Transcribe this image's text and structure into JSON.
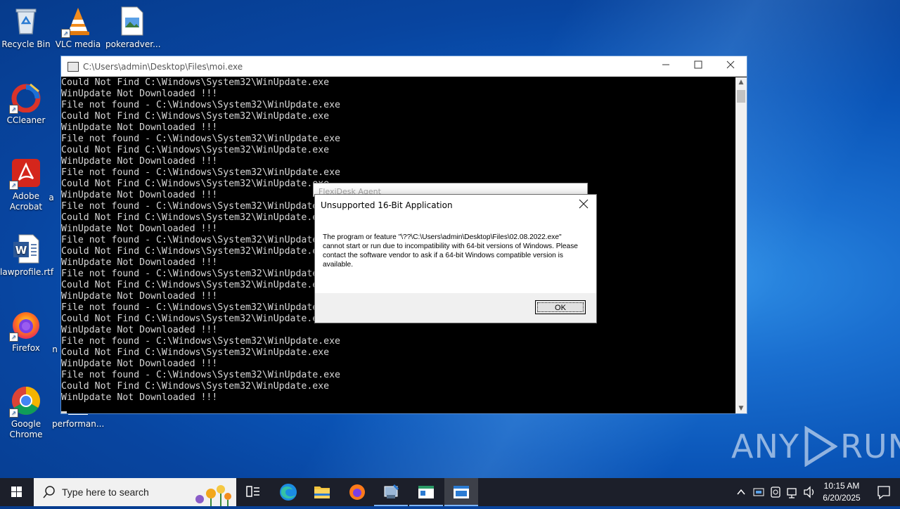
{
  "desktop": {
    "icons": [
      {
        "label": "Recycle Bin",
        "icon": "recycle-bin-icon"
      },
      {
        "label": "VLC media",
        "icon": "vlc-icon"
      },
      {
        "label": "pokeradver...",
        "icon": "image-file-icon"
      },
      {
        "label": "CCleaner",
        "icon": "ccleaner-icon"
      },
      {
        "label": "Adobe Acrobat",
        "icon": "acrobat-icon"
      },
      {
        "label": "lawprofile.rtf",
        "icon": "word-doc-icon"
      },
      {
        "label": "Firefox",
        "icon": "firefox-icon"
      },
      {
        "label": "Google Chrome",
        "icon": "chrome-icon"
      },
      {
        "label": "performan...",
        "icon": "file-icon"
      },
      {
        "label": "a",
        "icon": "file-icon"
      },
      {
        "label": "n",
        "icon": "file-icon"
      }
    ]
  },
  "console": {
    "title": "C:\\Users\\admin\\Desktop\\Files\\moi.exe",
    "lines": [
      "Could Not Find C:\\Windows\\System32\\WinUpdate.exe",
      "WinUpdate Not Downloaded !!!",
      "File not found - C:\\Windows\\System32\\WinUpdate.exe",
      "Could Not Find C:\\Windows\\System32\\WinUpdate.exe",
      "WinUpdate Not Downloaded !!!",
      "File not found - C:\\Windows\\System32\\WinUpdate.exe",
      "Could Not Find C:\\Windows\\System32\\WinUpdate.exe",
      "WinUpdate Not Downloaded !!!",
      "File not found - C:\\Windows\\System32\\WinUpdate.exe",
      "Could Not Find C:\\Windows\\System32\\WinUpdate.exe",
      "WinUpdate Not Downloaded !!!",
      "File not found - C:\\Windows\\System32\\WinUpdate.exe",
      "Could Not Find C:\\Windows\\System32\\WinUpdate.exe",
      "WinUpdate Not Downloaded !!!",
      "File not found - C:\\Windows\\System32\\WinUpdate.exe",
      "Could Not Find C:\\Windows\\System32\\WinUpdate.exe",
      "WinUpdate Not Downloaded !!!",
      "File not found - C:\\Windows\\System32\\WinUpdate.exe",
      "Could Not Find C:\\Windows\\System32\\WinUpdate.exe",
      "WinUpdate Not Downloaded !!!",
      "File not found - C:\\Windows\\System32\\WinUpdate.exe",
      "Could Not Find C:\\Windows\\System32\\WinUpdate.exe",
      "WinUpdate Not Downloaded !!!",
      "File not found - C:\\Windows\\System32\\WinUpdate.exe",
      "Could Not Find C:\\Windows\\System32\\WinUpdate.exe",
      "WinUpdate Not Downloaded !!!",
      "File not found - C:\\Windows\\System32\\WinUpdate.exe",
      "Could Not Find C:\\Windows\\System32\\WinUpdate.exe",
      "WinUpdate Not Downloaded !!!"
    ]
  },
  "background_dialog": {
    "title": "FlexiDesk Agent"
  },
  "dialog": {
    "title": "Unsupported 16-Bit Application",
    "message": "The program or feature \"\\??\\C:\\Users\\admin\\Desktop\\Files\\02.08.2022.exe\" cannot start or run due to incompatibility with 64-bit versions of Windows. Please contact the software vendor to ask if a 64-bit Windows compatible version is available.",
    "ok_label": "OK"
  },
  "watermark": {
    "left": "ANY",
    "right": "RUN"
  },
  "taskbar": {
    "search_placeholder": "Type here to search",
    "time": "10:15 AM",
    "date": "6/20/2025"
  },
  "colors": {
    "console_bg": "#000000",
    "console_text": "#d8d8d8",
    "taskbar": "#1c1f2a",
    "accent": "#0a55b8"
  }
}
